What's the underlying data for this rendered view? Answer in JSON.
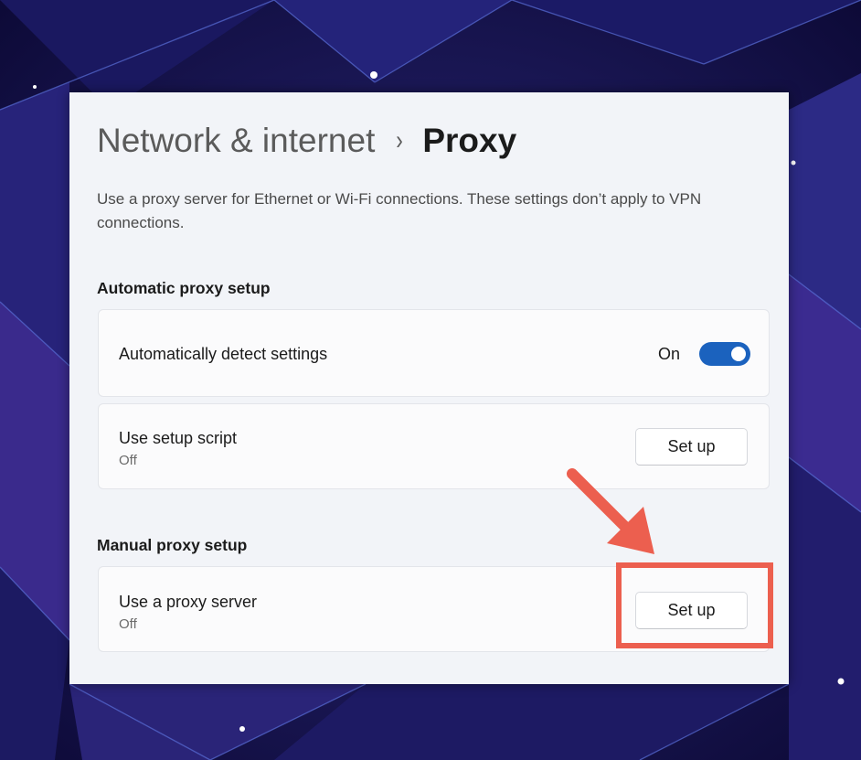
{
  "breadcrumb": {
    "parent": "Network & internet",
    "separator": "›",
    "current": "Proxy"
  },
  "description": "Use a proxy server for Ethernet or Wi-Fi connections. These settings don’t apply to VPN connections.",
  "automatic": {
    "title": "Automatic proxy setup",
    "detect": {
      "label": "Automatically detect settings",
      "state_label": "On",
      "enabled": true
    },
    "script": {
      "label": "Use setup script",
      "status": "Off",
      "button_label": "Set up"
    }
  },
  "manual": {
    "title": "Manual proxy setup",
    "proxy_server": {
      "label": "Use a proxy server",
      "status": "Off",
      "button_label": "Set up"
    }
  },
  "colors": {
    "accent": "#1b62be",
    "annotation": "#ec5f4f",
    "panel": "#f2f4f8"
  },
  "icons": {
    "breadcrumb_separator": "chevron-right-icon",
    "annotation_arrow": "arrow-icon"
  }
}
